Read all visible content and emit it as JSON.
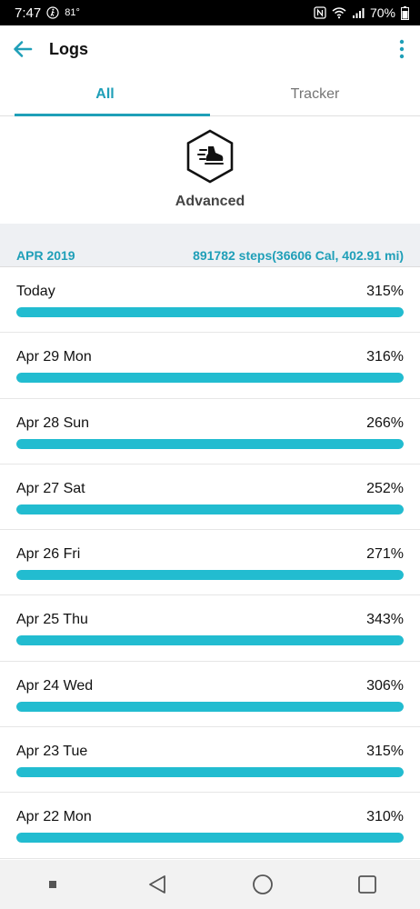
{
  "status_bar": {
    "time": "7:47",
    "temperature": "81°",
    "battery": "70%",
    "icons": [
      "walking-icon",
      "nfc-icon",
      "wifi-icon",
      "signal-icon",
      "battery-icon"
    ]
  },
  "app_bar": {
    "title": "Logs",
    "back_icon": "arrow-left-icon",
    "menu_icon": "more-vert-icon"
  },
  "tabs": [
    {
      "label": "All",
      "active": true
    },
    {
      "label": "Tracker",
      "active": false
    }
  ],
  "hero": {
    "icon": "shoe-hexagon-icon",
    "label": "Advanced"
  },
  "summary": {
    "month": "APR 2019",
    "total": "891782 steps(36606 Cal, 402.91 mi)"
  },
  "logs": [
    {
      "label": "Today",
      "value": "315%",
      "progress": 1.0
    },
    {
      "label": "Apr 29 Mon",
      "value": "316%",
      "progress": 1.0
    },
    {
      "label": "Apr 28 Sun",
      "value": "266%",
      "progress": 1.0
    },
    {
      "label": "Apr 27 Sat",
      "value": "252%",
      "progress": 1.0
    },
    {
      "label": "Apr 26 Fri",
      "value": "271%",
      "progress": 1.0
    },
    {
      "label": "Apr 25 Thu",
      "value": "343%",
      "progress": 1.0
    },
    {
      "label": "Apr 24 Wed",
      "value": "306%",
      "progress": 1.0
    },
    {
      "label": "Apr 23 Tue",
      "value": "315%",
      "progress": 1.0
    },
    {
      "label": "Apr 22 Mon",
      "value": "310%",
      "progress": 1.0
    }
  ],
  "colors": {
    "accent": "#1f9fb8",
    "bar": "#22bcd0"
  }
}
